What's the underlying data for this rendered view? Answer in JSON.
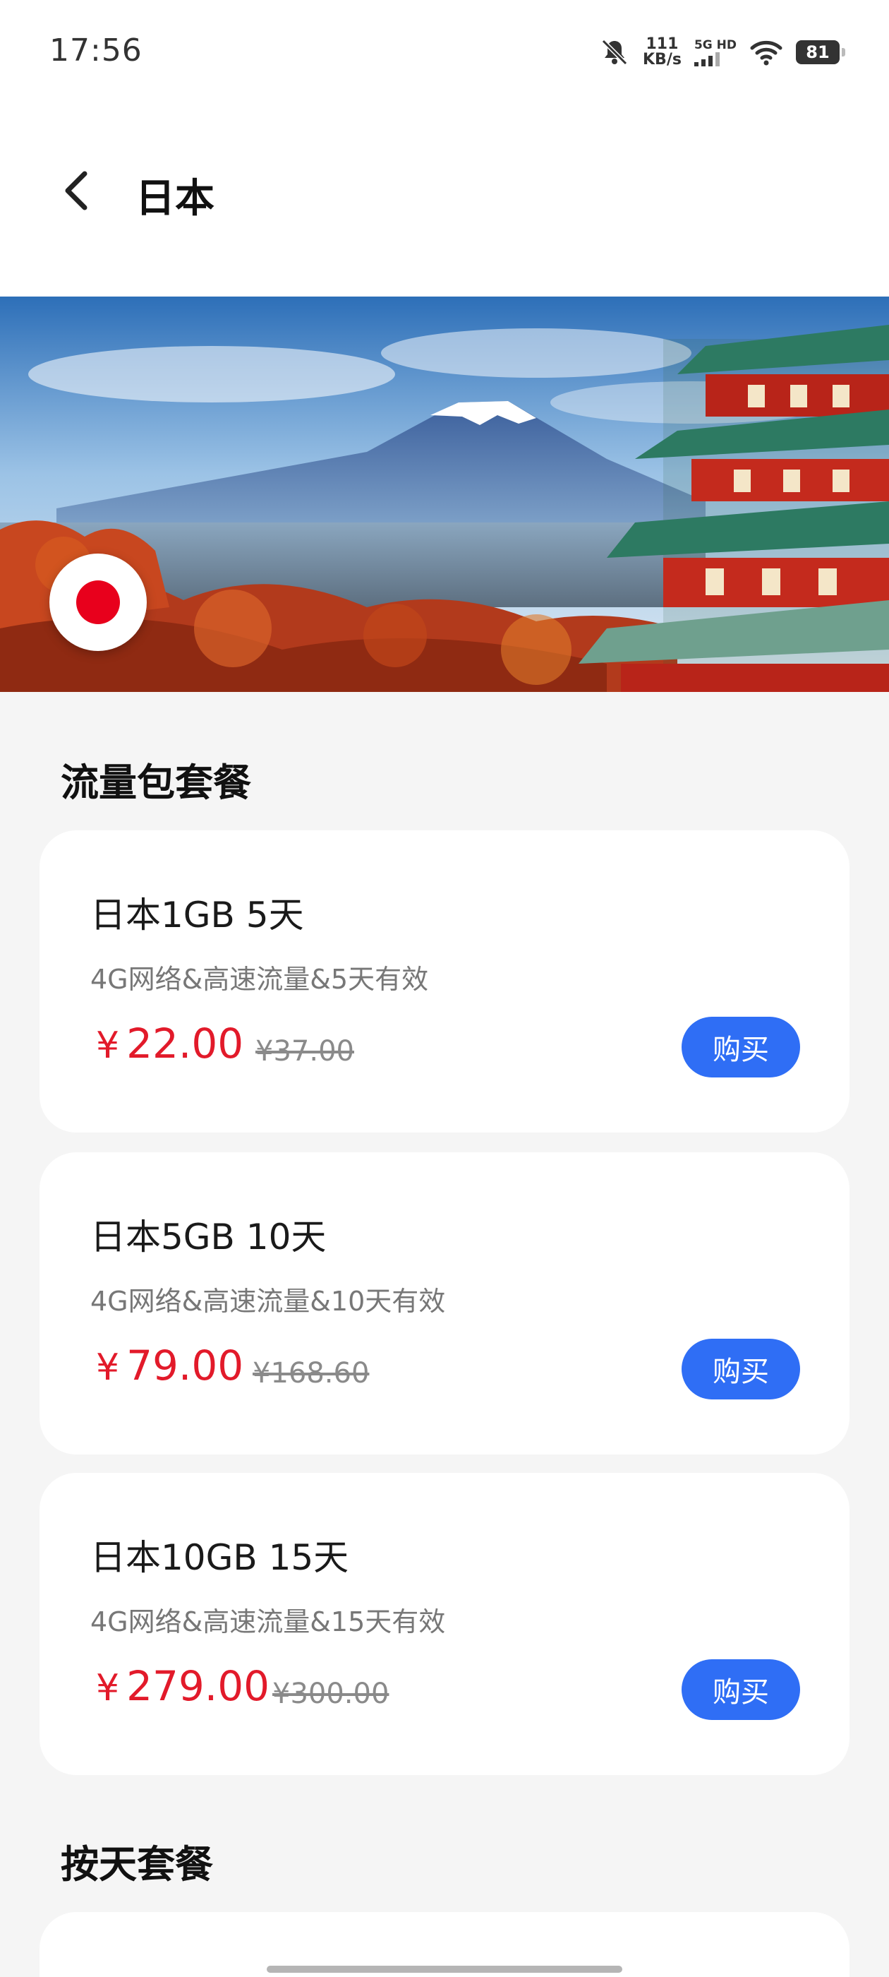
{
  "status_bar": {
    "time": "17:56",
    "net_speed_value": "111",
    "net_speed_unit": "KB/s",
    "signal_label": "5G HD",
    "battery": "81",
    "icons": [
      "bell-muted-icon",
      "signal-icon",
      "wifi-icon",
      "battery-icon"
    ]
  },
  "header": {
    "title": "日本",
    "back_icon": "chevron-left-icon"
  },
  "banner": {
    "flag_icon": "japan-flag-icon",
    "colors": {
      "flag_red": "#e8001c"
    }
  },
  "sections": {
    "data_packages_title": "流量包套餐",
    "daily_packages_title": "按天套餐"
  },
  "packages": [
    {
      "name": "日本1GB 5天",
      "desc": "4G网络&高速流量&5天有效",
      "currency": "¥",
      "price": "22.00",
      "original": "¥37.00",
      "buy_label": "购买"
    },
    {
      "name": "日本5GB 10天",
      "desc": "4G网络&高速流量&10天有效",
      "currency": "¥",
      "price": "79.00",
      "original": "¥168.60",
      "buy_label": "购买"
    },
    {
      "name": "日本10GB 15天",
      "desc": "4G网络&高速流量&15天有效",
      "currency": "¥",
      "price": "279.00",
      "original": "¥300.00",
      "buy_label": "购买"
    }
  ],
  "theme": {
    "accent": "#2f6ef5",
    "price_red": "#e21a2a",
    "background": "#f5f5f5"
  }
}
